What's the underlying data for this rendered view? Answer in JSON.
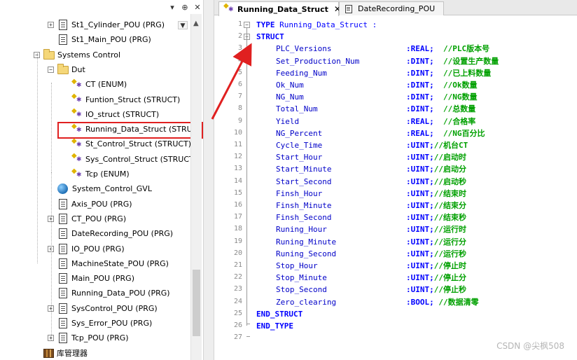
{
  "tree": {
    "toolbar": [
      "▾",
      "⊕",
      "✕"
    ],
    "items": [
      {
        "label": "St1_Cylinder_POU (PRG)",
        "icon": "pou-icon",
        "expander": "+",
        "indent": 1
      },
      {
        "label": "St1_Main_POU (PRG)",
        "icon": "pou-icon",
        "expander": "",
        "indent": 1
      },
      {
        "label": "Systems Control",
        "icon": "folder-icon",
        "expander": "−",
        "indent": 0
      },
      {
        "label": "Dut",
        "icon": "folder-icon",
        "expander": "−",
        "indent": 1
      },
      {
        "label": "CT (ENUM)",
        "icon": "dut-icon",
        "expander": "",
        "indent": 2
      },
      {
        "label": "Funtion_Struct (STRUCT)",
        "icon": "dut-icon",
        "expander": "",
        "indent": 2
      },
      {
        "label": "IO_struct (STRUCT)",
        "icon": "dut-icon",
        "expander": "",
        "indent": 2
      },
      {
        "label": "Running_Data_Struct (STRUCT",
        "icon": "dut-icon",
        "expander": "",
        "indent": 2
      },
      {
        "label": "St_Control_Struct (STRUCT)",
        "icon": "dut-icon",
        "expander": "",
        "indent": 2
      },
      {
        "label": "Sys_Control_Struct (STRUCT)",
        "icon": "dut-icon",
        "expander": "",
        "indent": 2
      },
      {
        "label": "Tcp (ENUM)",
        "icon": "dut-icon",
        "expander": "",
        "indent": 2
      },
      {
        "label": "System_Control_GVL",
        "icon": "gvl-icon",
        "expander": "",
        "indent": 1
      },
      {
        "label": "Axis_POU (PRG)",
        "icon": "pou-icon",
        "expander": "",
        "indent": 1
      },
      {
        "label": "CT_POU (PRG)",
        "icon": "pou-icon",
        "expander": "+",
        "indent": 1
      },
      {
        "label": "DateRecording_POU (PRG)",
        "icon": "pou-icon",
        "expander": "",
        "indent": 1
      },
      {
        "label": "IO_POU (PRG)",
        "icon": "pou-icon",
        "expander": "+",
        "indent": 1
      },
      {
        "label": "MachineState_POU (PRG)",
        "icon": "pou-icon",
        "expander": "",
        "indent": 1
      },
      {
        "label": "Main_POU (PRG)",
        "icon": "pou-icon",
        "expander": "",
        "indent": 1
      },
      {
        "label": "Running_Data_POU (PRG)",
        "icon": "pou-icon",
        "expander": "",
        "indent": 1
      },
      {
        "label": "SysControl_POU (PRG)",
        "icon": "pou-icon",
        "expander": "+",
        "indent": 1
      },
      {
        "label": "Sys_Error_POU (PRG)",
        "icon": "pou-icon",
        "expander": "",
        "indent": 1
      },
      {
        "label": "Tcp_POU (PRG)",
        "icon": "pou-icon",
        "expander": "+",
        "indent": 1
      },
      {
        "label": "库管理器",
        "icon": "library-icon",
        "expander": "",
        "indent": 0
      }
    ],
    "selected_index": 7
  },
  "tabs": [
    {
      "label": "Running_Data_Struct",
      "active": true,
      "close": "✕"
    },
    {
      "label": "DateRecording_POU",
      "active": false
    }
  ],
  "code": [
    {
      "n": "1",
      "fold": "−",
      "kind": "header",
      "kw": "TYPE",
      "name": "Running_Data_Struct :"
    },
    {
      "n": "2",
      "fold": "−",
      "kind": "kw",
      "kw": "STRUCT"
    },
    {
      "n": "3",
      "kind": "var",
      "var": "PLC_Versions",
      "type": ":REAL;",
      "comment": "  //PLC版本号"
    },
    {
      "n": "4",
      "kind": "var",
      "var": "Set_Production_Num",
      "type": ":DINT;",
      "comment": "  //设置生产数量"
    },
    {
      "n": "5",
      "kind": "var",
      "var": "Feeding_Num",
      "type": ":DINT;",
      "comment": "  //已上料数量"
    },
    {
      "n": "6",
      "kind": "var",
      "var": "Ok_Num",
      "type": ":DINT;",
      "comment": "  //Ok数量"
    },
    {
      "n": "7",
      "kind": "var",
      "var": "NG_Num",
      "type": ":DINT;",
      "comment": "  //NG数量"
    },
    {
      "n": "8",
      "kind": "var",
      "var": "Total_Num",
      "type": ":DINT;",
      "comment": "  //总数量"
    },
    {
      "n": "9",
      "kind": "var",
      "var": "Yield",
      "type": ":REAL;",
      "comment": "  //合格率"
    },
    {
      "n": "10",
      "kind": "var",
      "var": "NG_Percent",
      "type": ":REAL;",
      "comment": "  //NG百分比"
    },
    {
      "n": "11",
      "kind": "var",
      "var": "Cycle_Time",
      "type": ":UINT;",
      "comment": "//机台CT"
    },
    {
      "n": "12",
      "kind": "var",
      "var": "Start_Hour",
      "type": ":UINT;",
      "comment": "//启动时"
    },
    {
      "n": "13",
      "kind": "var",
      "var": "Start_Minute",
      "type": ":UINT;",
      "comment": "//启动分"
    },
    {
      "n": "14",
      "kind": "var",
      "var": "Start_Second",
      "type": ":UINT;",
      "comment": "//启动秒"
    },
    {
      "n": "15",
      "kind": "var",
      "var": "Finsh_Hour",
      "type": ":UINT;",
      "comment": "//结束时"
    },
    {
      "n": "16",
      "kind": "var",
      "var": "Finsh_Minute",
      "type": ":UINT;",
      "comment": "//结束分"
    },
    {
      "n": "17",
      "kind": "var",
      "var": "Finsh_Second",
      "type": ":UINT;",
      "comment": "//结束秒"
    },
    {
      "n": "18",
      "kind": "var",
      "var": "Runing_Hour",
      "type": ":UINT;",
      "comment": "//运行时"
    },
    {
      "n": "19",
      "kind": "var",
      "var": "Runing_Minute",
      "type": ":UINT;",
      "comment": "//运行分"
    },
    {
      "n": "20",
      "kind": "var",
      "var": "Runing_Second",
      "type": ":UINT;",
      "comment": "//运行秒"
    },
    {
      "n": "21",
      "kind": "var",
      "var": "Stop_Hour",
      "type": ":UINT;",
      "comment": "//停止时"
    },
    {
      "n": "22",
      "kind": "var",
      "var": "Stop_Minute",
      "type": ":UINT;",
      "comment": "//停止分"
    },
    {
      "n": "23",
      "kind": "var",
      "var": "Stop_Second",
      "type": ":UINT;",
      "comment": "//停止秒"
    },
    {
      "n": "24",
      "kind": "var",
      "var": "Zero_clearing",
      "type": ":BOOL;",
      "comment": " //数据清零"
    },
    {
      "n": "25",
      "kind": "kw",
      "kw": "END_STRUCT"
    },
    {
      "n": "26",
      "kind": "kw",
      "kw": "END_TYPE"
    },
    {
      "n": "27",
      "kind": "blank"
    }
  ],
  "watermark": "CSDN @尖枫508",
  "colors": {
    "highlight": "#e02020",
    "keyword": "#0000ff",
    "comment": "#00a000"
  }
}
